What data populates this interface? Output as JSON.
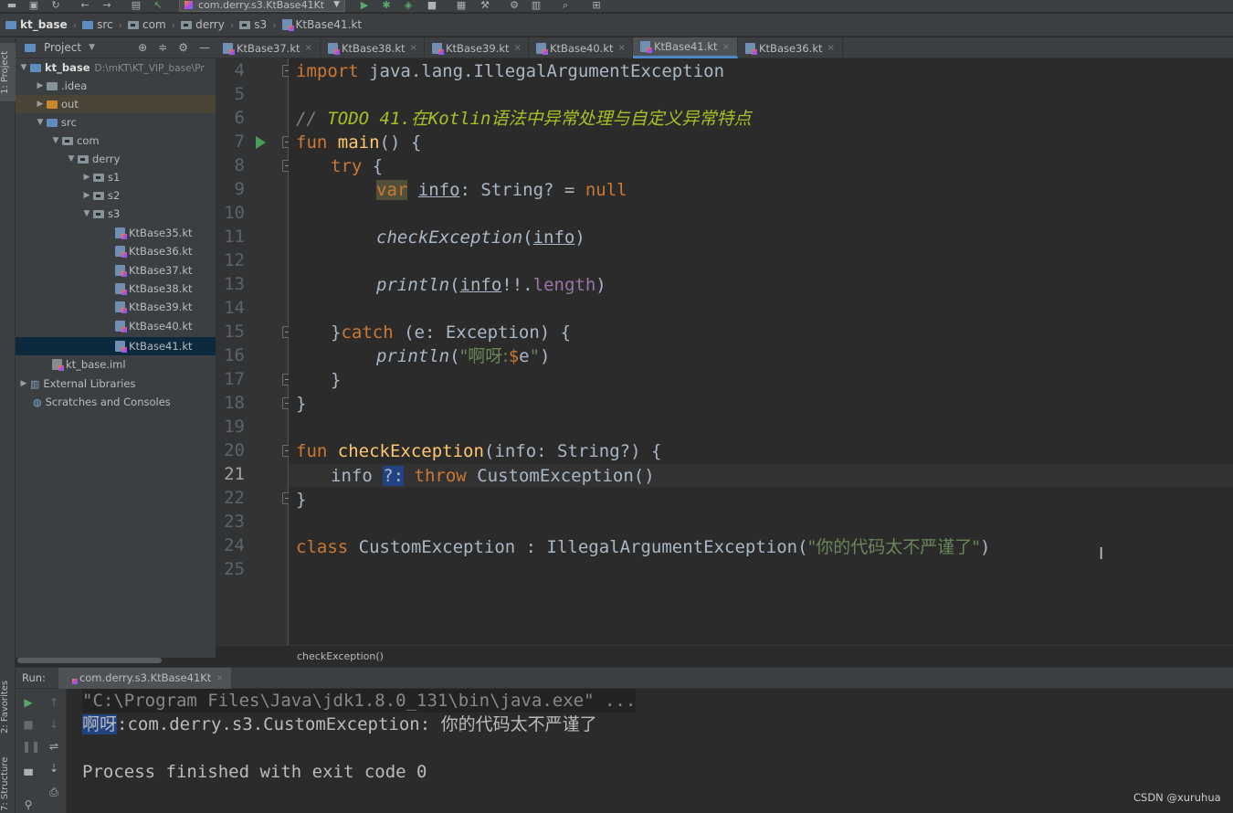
{
  "toolbar": {
    "run_config": "com.derry.s3.KtBase41Kt"
  },
  "breadcrumb": {
    "items": [
      "kt_base",
      "src",
      "com",
      "derry",
      "s3",
      "KtBase41.kt"
    ]
  },
  "left_strip": {
    "project_tab": "1: Project",
    "favorites_tab": "2: Favorites",
    "structure_tab": "7: Structure"
  },
  "project_panel": {
    "title": "Project",
    "tree": [
      {
        "label": "kt_base",
        "path": "D:\\mKT\\KT_VIP_base\\Pr"
      },
      {
        "label": ".idea"
      },
      {
        "label": "out"
      },
      {
        "label": "src"
      },
      {
        "label": "com"
      },
      {
        "label": "derry"
      },
      {
        "label": "s1"
      },
      {
        "label": "s2"
      },
      {
        "label": "s3"
      },
      {
        "label": "KtBase35.kt"
      },
      {
        "label": "KtBase36.kt"
      },
      {
        "label": "KtBase37.kt"
      },
      {
        "label": "KtBase38.kt"
      },
      {
        "label": "KtBase39.kt"
      },
      {
        "label": "KtBase40.kt"
      },
      {
        "label": "KtBase41.kt"
      },
      {
        "label": "kt_base.iml"
      },
      {
        "label": "External Libraries"
      },
      {
        "label": "Scratches and Consoles"
      }
    ]
  },
  "editor": {
    "tabs": [
      {
        "label": "KtBase37.kt"
      },
      {
        "label": "KtBase38.kt"
      },
      {
        "label": "KtBase39.kt"
      },
      {
        "label": "KtBase40.kt"
      },
      {
        "label": "KtBase41.kt"
      },
      {
        "label": "KtBase36.kt"
      }
    ],
    "active_tab": "KtBase41.kt",
    "line_numbers": [
      "4",
      "5",
      "6",
      "7",
      "8",
      "9",
      "10",
      "11",
      "12",
      "13",
      "14",
      "15",
      "16",
      "17",
      "18",
      "19",
      "20",
      "21",
      "22",
      "23",
      "24",
      "25"
    ],
    "current_line": "21",
    "code": {
      "l4_import": "import",
      "l4_rest": " java.lang.IllegalArgumentException",
      "l6_comment": "// ",
      "l6_todo": "TODO 41.在Kotlin语法中异常处理与自定义异常特点",
      "l7_fun": "fun",
      "l7_name": "main",
      "l7_rest": "() {",
      "l8_try": "try",
      "l8_rest": " {",
      "l9_var": "var",
      "l9_info": "info",
      "l9_type": ": String? = ",
      "l9_null": "null",
      "l11_call": "checkException",
      "l11_open": "(",
      "l11_arg": "info",
      "l11_close": ")",
      "l13_call": "println",
      "l13_open": "(",
      "l13_arg": "info",
      "l13_bang": "!!.",
      "l13_length": "length",
      "l13_close": ")",
      "l15_brace": "}",
      "l15_catch": "catch",
      "l15_rest": " (e: Exception) {",
      "l16_call": "println",
      "l16_open": "(",
      "l16_str": "\"啊呀:",
      "l16_tmpl": "$",
      "l16_e": "e",
      "l16_strend": "\"",
      "l16_close": ")",
      "l17": "}",
      "l18": "}",
      "l20_fun": "fun",
      "l20_name": "checkException",
      "l20_rest": "(info: String?) {",
      "l21_info": "info ",
      "l21_elvis": "?:",
      "l21_throw": "throw",
      "l21_rest": " CustomException()",
      "l22": "}",
      "l24_class": "class",
      "l24_rest": " CustomException : IllegalArgumentException(",
      "l24_str": "\"你的代码太不严谨了\"",
      "l24_close": ")"
    },
    "crumb": "checkException()"
  },
  "run_panel": {
    "label": "Run:",
    "tab": "com.derry.s3.KtBase41Kt",
    "console": {
      "cmd": "\"C:\\Program Files\\Java\\jdk1.8.0_131\\bin\\java.exe\" ...",
      "out_sel": "啊呀",
      "out_rest": ":com.derry.s3.CustomException: 你的代码太不严谨了",
      "exit": "Process finished with exit code 0"
    }
  },
  "watermark": "CSDN @xuruhua",
  "colors": {
    "keyword": "#cc7832",
    "function": "#ffc66d",
    "string": "#6a8759",
    "todo": "#a8c023",
    "property": "#9876aa",
    "selection": "#214283",
    "background": "#2b2b2b"
  }
}
